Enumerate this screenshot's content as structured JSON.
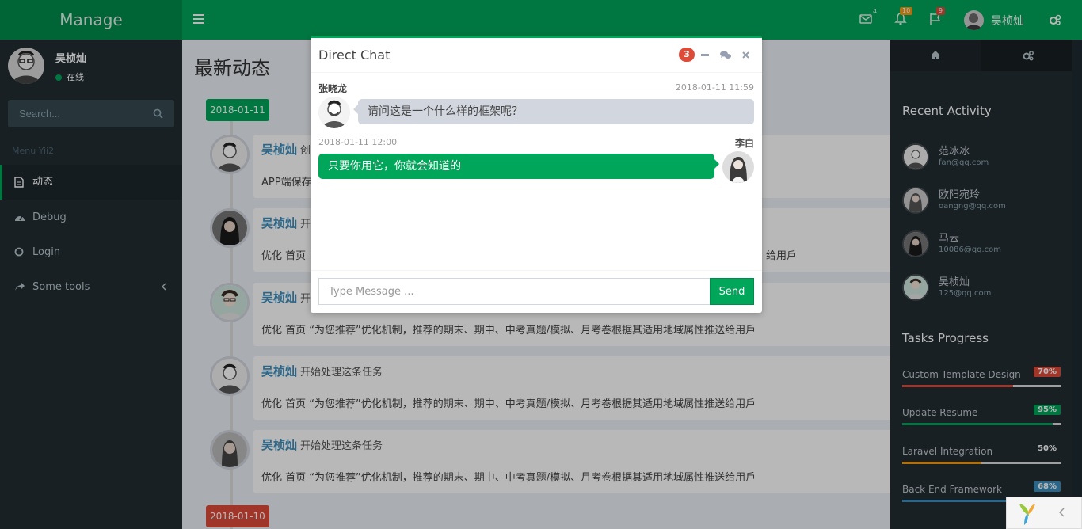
{
  "app": {
    "logo": "Manage"
  },
  "navbar": {
    "mail_count": "4",
    "bell_count": "10",
    "flag_count": "9",
    "user_name": "吴桢灿"
  },
  "sidebar": {
    "user_name": "吴桢灿",
    "status": "在线",
    "search_placeholder": "Search...",
    "menu_header": "Menu Yii2",
    "items": [
      {
        "label": "动态",
        "icon": "dashboard-icon"
      },
      {
        "label": "Debug",
        "icon": "gauge-icon"
      },
      {
        "label": "Login",
        "icon": "circle-icon"
      },
      {
        "label": "Some tools",
        "icon": "share-icon"
      }
    ]
  },
  "main": {
    "title": "最新动态",
    "dates": [
      "2018-01-11",
      "2018-01-10"
    ],
    "items": [
      {
        "author": "吴桢灿",
        "action": "创",
        "body": "APP端保存"
      },
      {
        "author": "吴桢灿",
        "action": "开",
        "body": "优化 首页"
      },
      {
        "author": "吴桢灿",
        "action": "开",
        "body": "优化 首页 “为您推荐”优化机制，推荐的期末、期中、中考真题/模拟、月考卷根据其适用地域属性推送给用戶"
      },
      {
        "author": "吴桢灿",
        "action": "开始处理这条任务",
        "body": "优化 首页 “为您推荐”优化机制，推荐的期末、期中、中考真题/模拟、月考卷根据其适用地域属性推送给用戶"
      },
      {
        "author": "吴桢灿",
        "action": "开始处理这条任务",
        "body": "优化 首页 “为您推荐”优化机制，推荐的期末、期中、中考真题/模拟、月考卷根据其适用地域属性推送给用戶"
      }
    ],
    "partial_tail": "给用戶"
  },
  "control_sidebar": {
    "recent_title": "Recent Activity",
    "activities": [
      {
        "name": "范冰冰",
        "email": "fan@qq.com"
      },
      {
        "name": "欧阳宛玲",
        "email": "oangng@qq.com"
      },
      {
        "name": "马云",
        "email": "10086@qq.com"
      },
      {
        "name": "吴桢灿",
        "email": "125@qq.com"
      }
    ],
    "tasks_title": "Tasks Progress",
    "tasks": [
      {
        "name": "Custom Template Design",
        "badge": "70%",
        "progress": 0.7,
        "color": "#dd4b39"
      },
      {
        "name": "Update Resume",
        "badge": "95%",
        "progress": 0.95,
        "color": "#00a65a"
      },
      {
        "name": "Laravel Integration",
        "badge": "50%",
        "progress": 0.5,
        "color": "#f39c12"
      },
      {
        "name": "Back End Framework",
        "badge": "68%",
        "progress": 0.68,
        "color": "#3c8dbc"
      }
    ]
  },
  "chat": {
    "title": "Direct Chat",
    "count": "3",
    "messages": [
      {
        "name": "张晓龙",
        "time": "2018-01-11 11:59",
        "text": "请问这是一个什么样的框架呢？"
      },
      {
        "name": "李白",
        "time": "2018-01-11 12:00",
        "text": "只要你用它，你就会知道的"
      }
    ],
    "input_placeholder": "Type Message ...",
    "send_label": "Send"
  },
  "colors": {
    "primary": "#00a65a",
    "primary_dark": "#008d4c",
    "sidebar": "#222d32",
    "danger": "#dd4b39"
  }
}
